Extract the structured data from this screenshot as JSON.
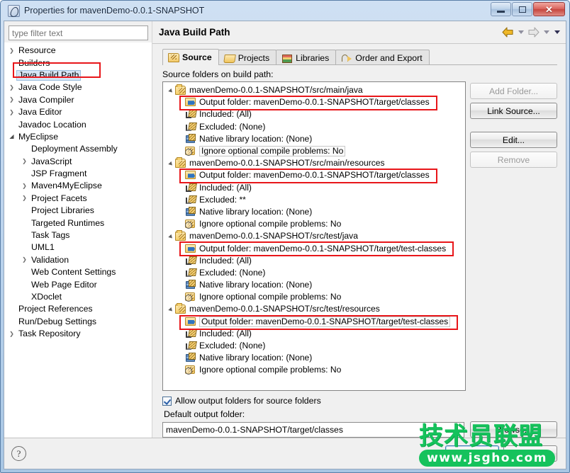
{
  "window": {
    "title": "Properties for mavenDemo-0.0.1-SNAPSHOT",
    "minimize_label": "",
    "maximize_label": "",
    "close_label": "✕"
  },
  "sidebar": {
    "filter_placeholder": "type filter text",
    "filter_value": "",
    "items": [
      {
        "label": "Resource",
        "indent": 1,
        "arrow": "collapsed",
        "selected": false
      },
      {
        "label": "Builders",
        "indent": 1,
        "arrow": "none",
        "selected": false
      },
      {
        "label": "Java Build Path",
        "indent": 1,
        "arrow": "none",
        "selected": true
      },
      {
        "label": "Java Code Style",
        "indent": 1,
        "arrow": "collapsed",
        "selected": false
      },
      {
        "label": "Java Compiler",
        "indent": 1,
        "arrow": "collapsed",
        "selected": false
      },
      {
        "label": "Java Editor",
        "indent": 1,
        "arrow": "collapsed",
        "selected": false
      },
      {
        "label": "Javadoc Location",
        "indent": 1,
        "arrow": "none",
        "selected": false
      },
      {
        "label": "MyEclipse",
        "indent": 1,
        "arrow": "expanded",
        "selected": false
      },
      {
        "label": "Deployment Assembly",
        "indent": 2,
        "arrow": "none",
        "selected": false
      },
      {
        "label": "JavaScript",
        "indent": 2,
        "arrow": "collapsed",
        "selected": false
      },
      {
        "label": "JSP Fragment",
        "indent": 2,
        "arrow": "none",
        "selected": false
      },
      {
        "label": "Maven4MyEclipse",
        "indent": 2,
        "arrow": "collapsed",
        "selected": false
      },
      {
        "label": "Project Facets",
        "indent": 2,
        "arrow": "collapsed",
        "selected": false
      },
      {
        "label": "Project Libraries",
        "indent": 2,
        "arrow": "none",
        "selected": false
      },
      {
        "label": "Targeted Runtimes",
        "indent": 2,
        "arrow": "none",
        "selected": false
      },
      {
        "label": "Task Tags",
        "indent": 2,
        "arrow": "none",
        "selected": false
      },
      {
        "label": "UML1",
        "indent": 2,
        "arrow": "none",
        "selected": false
      },
      {
        "label": "Validation",
        "indent": 2,
        "arrow": "collapsed",
        "selected": false
      },
      {
        "label": "Web Content Settings",
        "indent": 2,
        "arrow": "none",
        "selected": false
      },
      {
        "label": "Web Page Editor",
        "indent": 2,
        "arrow": "none",
        "selected": false
      },
      {
        "label": "XDoclet",
        "indent": 2,
        "arrow": "none",
        "selected": false
      },
      {
        "label": "Project References",
        "indent": 1,
        "arrow": "none",
        "selected": false
      },
      {
        "label": "Run/Debug Settings",
        "indent": 1,
        "arrow": "none",
        "selected": false
      },
      {
        "label": "Task Repository",
        "indent": 1,
        "arrow": "collapsed",
        "selected": false
      }
    ]
  },
  "header": {
    "title": "Java Build Path",
    "back_icon": "back-arrow-icon",
    "forward_icon": "forward-arrow-icon",
    "menu_icon": "view-menu-icon"
  },
  "tabs": [
    {
      "label": "Source",
      "icon": "source-folder-icon",
      "active": true
    },
    {
      "label": "Projects",
      "icon": "project-icon",
      "active": false
    },
    {
      "label": "Libraries",
      "icon": "library-books-icon",
      "active": false
    },
    {
      "label": "Order and Export",
      "icon": "order-export-icon",
      "active": false
    }
  ],
  "source_tab": {
    "list_label": "Source folders on build path:",
    "groups": [
      {
        "root": "mavenDemo-0.0.1-SNAPSHOT/src/main/java",
        "children": [
          {
            "label": "Output folder: mavenDemo-0.0.1-SNAPSHOT/target/classes",
            "icon": "output-folder-icon",
            "highlighted": true,
            "boxed": false
          },
          {
            "label": "Included: (All)",
            "icon": "included-icon",
            "highlighted": false,
            "boxed": false
          },
          {
            "label": "Excluded: (None)",
            "icon": "excluded-icon",
            "highlighted": false,
            "boxed": false
          },
          {
            "label": "Native library location: (None)",
            "icon": "native-library-icon",
            "highlighted": false,
            "boxed": false
          },
          {
            "label": "Ignore optional compile problems: No",
            "icon": "ignore-problems-icon",
            "highlighted": false,
            "boxed": true
          }
        ]
      },
      {
        "root": "mavenDemo-0.0.1-SNAPSHOT/src/main/resources",
        "children": [
          {
            "label": "Output folder: mavenDemo-0.0.1-SNAPSHOT/target/classes",
            "icon": "output-folder-icon",
            "highlighted": true,
            "boxed": false
          },
          {
            "label": "Included: (All)",
            "icon": "included-icon",
            "highlighted": false,
            "boxed": false
          },
          {
            "label": "Excluded: **",
            "icon": "excluded-icon",
            "highlighted": false,
            "boxed": false
          },
          {
            "label": "Native library location: (None)",
            "icon": "native-library-icon",
            "highlighted": false,
            "boxed": false
          },
          {
            "label": "Ignore optional compile problems: No",
            "icon": "ignore-problems-icon",
            "highlighted": false,
            "boxed": false
          }
        ]
      },
      {
        "root": "mavenDemo-0.0.1-SNAPSHOT/src/test/java",
        "children": [
          {
            "label": "Output folder: mavenDemo-0.0.1-SNAPSHOT/target/test-classes",
            "icon": "output-folder-icon",
            "highlighted": true,
            "boxed": false
          },
          {
            "label": "Included: (All)",
            "icon": "included-icon",
            "highlighted": false,
            "boxed": false
          },
          {
            "label": "Excluded: (None)",
            "icon": "excluded-icon",
            "highlighted": false,
            "boxed": false
          },
          {
            "label": "Native library location: (None)",
            "icon": "native-library-icon",
            "highlighted": false,
            "boxed": false
          },
          {
            "label": "Ignore optional compile problems: No",
            "icon": "ignore-problems-icon",
            "highlighted": false,
            "boxed": false
          }
        ]
      },
      {
        "root": "mavenDemo-0.0.1-SNAPSHOT/src/test/resources",
        "children": [
          {
            "label": "Output folder: mavenDemo-0.0.1-SNAPSHOT/target/test-classes",
            "icon": "output-folder-icon",
            "highlighted": true,
            "boxed": true
          },
          {
            "label": "Included: (All)",
            "icon": "included-icon",
            "highlighted": false,
            "boxed": false
          },
          {
            "label": "Excluded: (None)",
            "icon": "excluded-icon",
            "highlighted": false,
            "boxed": false
          },
          {
            "label": "Native library location: (None)",
            "icon": "native-library-icon",
            "highlighted": false,
            "boxed": false
          },
          {
            "label": "Ignore optional compile problems: No",
            "icon": "ignore-problems-icon",
            "highlighted": false,
            "boxed": false
          }
        ]
      }
    ],
    "buttons": [
      {
        "label": "Add Folder...",
        "enabled": false
      },
      {
        "label": "Link Source...",
        "enabled": true
      },
      {
        "label": "Edit...",
        "enabled": true
      },
      {
        "label": "Remove",
        "enabled": false
      }
    ],
    "allow_output_checkbox": {
      "label": "Allow output folders for source folders",
      "checked": true
    },
    "default_output_label": "Default output folder:",
    "default_output_value": "mavenDemo-0.0.1-SNAPSHOT/target/classes",
    "browse_label": "Browse..."
  },
  "footer": {
    "help_glyph": "?",
    "ok_label": "OK",
    "cancel_label": "Cancel"
  },
  "watermark": {
    "cn_text": "技术员联盟",
    "url_text": "www.jsgho.com",
    "color": "#15c25c"
  },
  "annotation": {
    "color": "#e8161a",
    "count": 5
  }
}
